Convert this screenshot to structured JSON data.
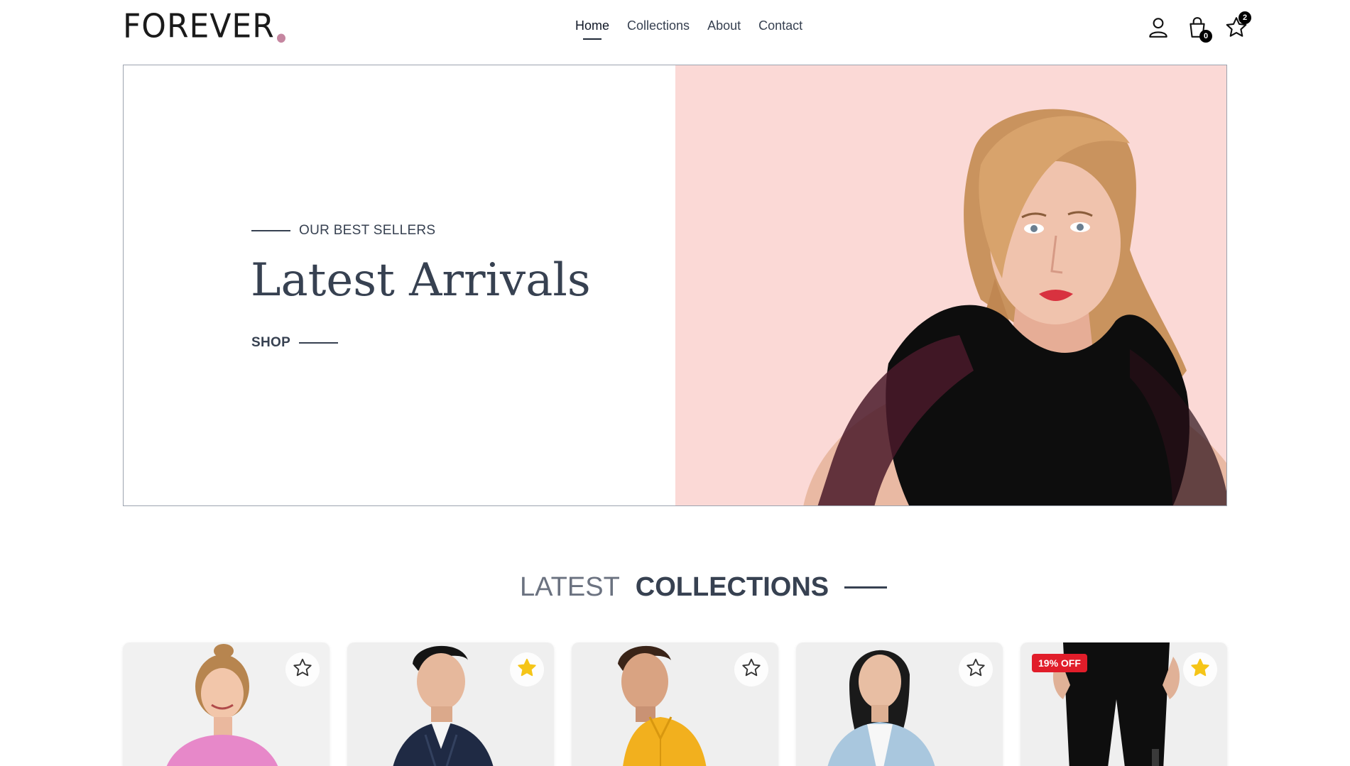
{
  "brand": {
    "logo_text": "FOREVER",
    "dot_color": "#c586a0"
  },
  "nav": {
    "items": [
      {
        "label": "Home",
        "active": true
      },
      {
        "label": "Collections",
        "active": false
      },
      {
        "label": "About",
        "active": false
      },
      {
        "label": "Contact",
        "active": false
      }
    ]
  },
  "header_icons": {
    "profile_icon": "user-icon",
    "cart_icon": "shopping-bag-icon",
    "cart_count": "0",
    "wishlist_icon": "star-icon",
    "wishlist_count": "2"
  },
  "hero": {
    "eyebrow": "OUR BEST SELLERS",
    "title": "Latest Arrivals",
    "cta": "SHOP",
    "image_bg": "#fbd9d6"
  },
  "latest_collections": {
    "heading_light": "LATEST",
    "heading_bold": "COLLECTIONS"
  },
  "products": [
    {
      "wishlisted": false,
      "discount": ""
    },
    {
      "wishlisted": true,
      "discount": ""
    },
    {
      "wishlisted": false,
      "discount": ""
    },
    {
      "wishlisted": false,
      "discount": ""
    },
    {
      "wishlisted": true,
      "discount": "19% OFF"
    }
  ],
  "colors": {
    "accent_star": "#f5c518",
    "discount_badge": "#e11d2a",
    "text_dark": "#1f2937"
  }
}
